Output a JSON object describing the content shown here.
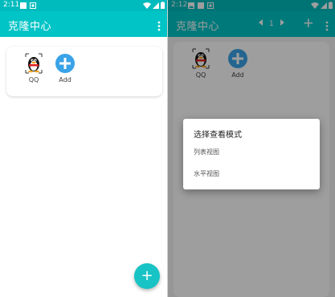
{
  "left_screen": {
    "status": {
      "time": "2:11"
    },
    "appbar": {
      "title": "克隆中心"
    },
    "apps": [
      {
        "label": "QQ",
        "icon": "penguin-icon"
      },
      {
        "label": "Add",
        "icon": "plus-circle-icon"
      }
    ],
    "fab": {
      "label": "+"
    }
  },
  "right_screen": {
    "status": {
      "time": "2:12"
    },
    "appbar": {
      "title": "克隆中心",
      "page": "1",
      "add_label": "+"
    },
    "apps": [
      {
        "label": "QQ",
        "icon": "penguin-icon"
      },
      {
        "label": "Add",
        "icon": "plus-circle-icon"
      }
    ],
    "dialog": {
      "title": "选择查看模式",
      "options": [
        "列表视图",
        "水平视图"
      ]
    }
  },
  "colors": {
    "primary": "#00c4c6",
    "accent": "#3aa3e8",
    "scrim": "rgba(0,0,0,0.38)"
  }
}
